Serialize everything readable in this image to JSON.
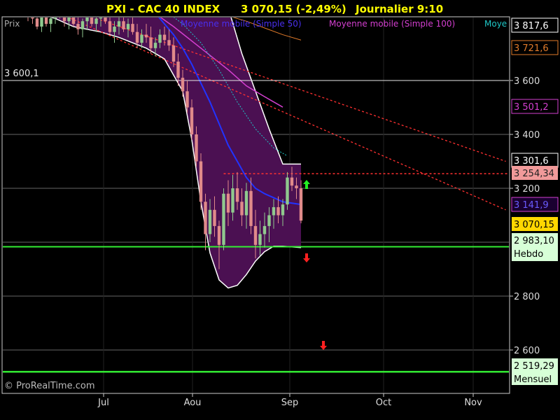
{
  "header": {
    "symbol_title": "PXI - CAC 40 INDEX",
    "price_change": "3 070,15 (-2,49%)",
    "timeframe": "Journalier  9:10"
  },
  "legend": {
    "price_label": "Prix",
    "ma50_label": "Moyenne mobile (Simple 50)",
    "ma100_label": "Moyenne mobile (Simple 100)",
    "ma_extra_label": "Moye"
  },
  "watermark": "© ProRealTime.com",
  "colors": {
    "background": "#000000",
    "bands_fill": "#4b1052",
    "bands_edge": "#ffffff",
    "candle_up": "#90c98e",
    "candle_down": "#e08a8a",
    "ma20": "#2233ff",
    "ma50": "#1fc7c7",
    "ma100": "#d43fd0",
    "ma200": "#e07a2a",
    "trend": "#ff3030",
    "support_green": "#33ee33",
    "grid": "#666666",
    "level_line": "#e8e8e8"
  },
  "chart_data": {
    "type": "candlestick",
    "title": "PXI - CAC 40 INDEX",
    "x_ticks": [
      "Jul",
      "Aou",
      "Sep",
      "Oct",
      "Nov"
    ],
    "y_ticks": [
      "2 600",
      "2 800",
      "3 200",
      "3 400",
      "3 600"
    ],
    "ylim": [
      2470,
      3870
    ],
    "level_label": "3 600,1",
    "price_labels": {
      "bb_upper": "3 817,6",
      "ma200": "3 721,6",
      "ma100": "3 501,2",
      "bb_mid": "3 301,6",
      "resistance": "3 254,34",
      "ma20": "3 141,9",
      "last": "3 070,15",
      "support_weekly": "2 983,10",
      "support_weekly_name": "Hebdo",
      "support_monthly": "2 519,29",
      "support_monthly_name": "Mensuel"
    },
    "levels": {
      "resistance": 3254.34,
      "support_weekly": 2983.1,
      "support_monthly": 2519.29,
      "level": 3600.1
    },
    "candles": [
      [
        3850,
        3880,
        3820,
        3840
      ],
      [
        3840,
        3870,
        3810,
        3830
      ],
      [
        3830,
        3860,
        3790,
        3800
      ],
      [
        3800,
        3850,
        3780,
        3840
      ],
      [
        3840,
        3870,
        3800,
        3810
      ],
      [
        3810,
        3850,
        3780,
        3830
      ],
      [
        3830,
        3880,
        3810,
        3860
      ],
      [
        3860,
        3900,
        3830,
        3850
      ],
      [
        3850,
        3880,
        3800,
        3820
      ],
      [
        3820,
        3860,
        3790,
        3840
      ],
      [
        3840,
        3870,
        3800,
        3810
      ],
      [
        3810,
        3840,
        3770,
        3790
      ],
      [
        3790,
        3830,
        3760,
        3820
      ],
      [
        3820,
        3860,
        3790,
        3840
      ],
      [
        3840,
        3870,
        3800,
        3810
      ],
      [
        3810,
        3850,
        3780,
        3830
      ],
      [
        3830,
        3870,
        3800,
        3850
      ],
      [
        3850,
        3880,
        3810,
        3820
      ],
      [
        3820,
        3850,
        3770,
        3780
      ],
      [
        3780,
        3820,
        3740,
        3800
      ],
      [
        3800,
        3840,
        3770,
        3820
      ],
      [
        3820,
        3850,
        3780,
        3790
      ],
      [
        3790,
        3830,
        3760,
        3810
      ],
      [
        3810,
        3840,
        3770,
        3780
      ],
      [
        3780,
        3810,
        3720,
        3740
      ],
      [
        3740,
        3790,
        3720,
        3770
      ],
      [
        3770,
        3810,
        3740,
        3760
      ],
      [
        3760,
        3800,
        3700,
        3720
      ],
      [
        3720,
        3760,
        3690,
        3740
      ],
      [
        3740,
        3790,
        3720,
        3770
      ],
      [
        3770,
        3800,
        3730,
        3750
      ],
      [
        3750,
        3790,
        3710,
        3730
      ],
      [
        3730,
        3760,
        3650,
        3670
      ],
      [
        3670,
        3700,
        3580,
        3610
      ],
      [
        3610,
        3640,
        3540,
        3560
      ],
      [
        3560,
        3600,
        3480,
        3500
      ],
      [
        3500,
        3530,
        3380,
        3400
      ],
      [
        3400,
        3430,
        3280,
        3300
      ],
      [
        3300,
        3330,
        3120,
        3150
      ],
      [
        3150,
        3180,
        2970,
        3030
      ],
      [
        3030,
        3160,
        3000,
        3120
      ],
      [
        3120,
        3170,
        3020,
        3060
      ],
      [
        3060,
        3080,
        2900,
        2990
      ],
      [
        2990,
        3200,
        2970,
        3180
      ],
      [
        3180,
        3230,
        3060,
        3110
      ],
      [
        3110,
        3250,
        3080,
        3200
      ],
      [
        3200,
        3260,
        3120,
        3150
      ],
      [
        3150,
        3200,
        3060,
        3100
      ],
      [
        3100,
        3220,
        3050,
        3190
      ],
      [
        3190,
        3240,
        3030,
        3060
      ],
      [
        3060,
        3120,
        2940,
        2990
      ],
      [
        2990,
        3080,
        2950,
        3030
      ],
      [
        3030,
        3110,
        2980,
        3060
      ],
      [
        3060,
        3130,
        3000,
        3100
      ],
      [
        3100,
        3160,
        3050,
        3130
      ],
      [
        3130,
        3170,
        3070,
        3100
      ],
      [
        3100,
        3160,
        3060,
        3140
      ],
      [
        3140,
        3260,
        3120,
        3240
      ],
      [
        3240,
        3280,
        3190,
        3210
      ],
      [
        3210,
        3240,
        3160,
        3200
      ],
      [
        3200,
        3230,
        3070,
        3080
      ]
    ],
    "bb_upper": [
      [
        0,
        3900
      ],
      [
        10,
        3890
      ],
      [
        20,
        3880
      ],
      [
        28,
        3860
      ],
      [
        32,
        3880
      ],
      [
        36,
        3890
      ],
      [
        42,
        3890
      ],
      [
        44,
        3870
      ],
      [
        47,
        3700
      ],
      [
        50,
        3560
      ],
      [
        53,
        3420
      ],
      [
        56,
        3290
      ],
      [
        60,
        3290
      ]
    ],
    "bb_lower": [
      [
        0,
        3860
      ],
      [
        6,
        3830
      ],
      [
        10,
        3800
      ],
      [
        16,
        3780
      ],
      [
        20,
        3760
      ],
      [
        26,
        3720
      ],
      [
        30,
        3680
      ],
      [
        34,
        3560
      ],
      [
        36,
        3380
      ],
      [
        38,
        3150
      ],
      [
        40,
        2960
      ],
      [
        42,
        2860
      ],
      [
        44,
        2830
      ],
      [
        46,
        2840
      ],
      [
        48,
        2880
      ],
      [
        50,
        2930
      ],
      [
        52,
        2965
      ],
      [
        54,
        2985
      ],
      [
        56,
        2985
      ],
      [
        60,
        2980
      ]
    ],
    "ma20": [
      [
        28,
        3850
      ],
      [
        30,
        3810
      ],
      [
        32,
        3770
      ],
      [
        34,
        3720
      ],
      [
        36,
        3660
      ],
      [
        38,
        3590
      ],
      [
        40,
        3520
      ],
      [
        42,
        3440
      ],
      [
        44,
        3360
      ],
      [
        46,
        3300
      ],
      [
        48,
        3240
      ],
      [
        50,
        3200
      ],
      [
        52,
        3180
      ],
      [
        54,
        3165
      ],
      [
        56,
        3150
      ],
      [
        60,
        3140
      ]
    ],
    "ma50": [
      [
        30,
        3860
      ],
      [
        34,
        3810
      ],
      [
        38,
        3740
      ],
      [
        42,
        3640
      ],
      [
        46,
        3520
      ],
      [
        50,
        3420
      ],
      [
        54,
        3350
      ],
      [
        57,
        3320
      ]
    ],
    "ma100": [
      [
        27,
        3860
      ],
      [
        32,
        3800
      ],
      [
        38,
        3720
      ],
      [
        44,
        3640
      ],
      [
        48,
        3580
      ],
      [
        52,
        3540
      ],
      [
        56,
        3501.2
      ]
    ],
    "ma200": [
      [
        42,
        3850
      ],
      [
        48,
        3820
      ],
      [
        56,
        3770
      ],
      [
        60,
        3750
      ]
    ],
    "trend1": [
      [
        0,
        3900
      ],
      [
        105,
        3120
      ]
    ],
    "trend2": [
      [
        15,
        3830
      ],
      [
        105,
        3300
      ]
    ]
  }
}
